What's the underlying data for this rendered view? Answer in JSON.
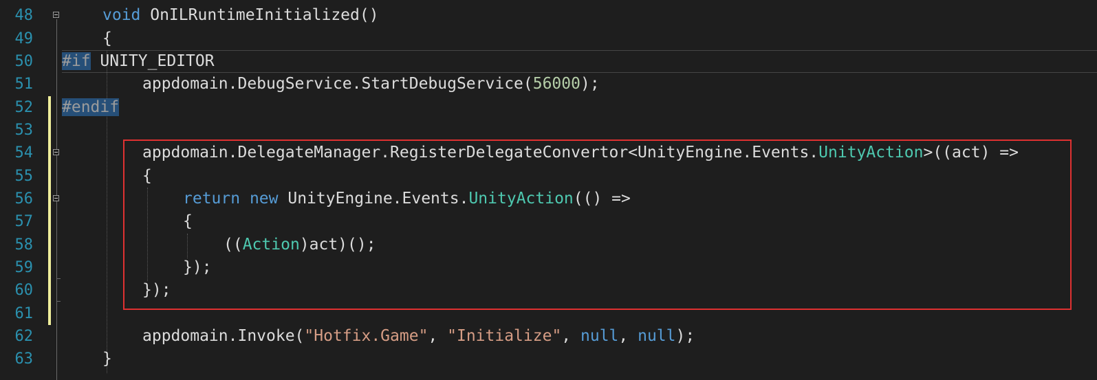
{
  "editor": {
    "language": "C#",
    "colors": {
      "background": "#1e1e1e",
      "line_number": "#2b91af",
      "keyword": "#569cd6",
      "type": "#4ec9b0",
      "number": "#b5cea8",
      "string": "#d69d85",
      "preprocessor": "#9b9b9b",
      "selection": "#264f78",
      "change_marker": "#f0ef9c",
      "annotation_box": "#e03131"
    },
    "lines": [
      {
        "num": "48",
        "tokens": [
          "void",
          " OnILRuntimeInitialized()"
        ]
      },
      {
        "num": "49",
        "tokens": [
          "{"
        ]
      },
      {
        "num": "50",
        "tokens": [
          "#if",
          " UNITY_EDITOR"
        ]
      },
      {
        "num": "51",
        "tokens": [
          "appdomain.DebugService.StartDebugService(",
          "56000",
          ");"
        ]
      },
      {
        "num": "52",
        "tokens": [
          "#endif"
        ]
      },
      {
        "num": "53",
        "tokens": []
      },
      {
        "num": "54",
        "tokens": [
          "appdomain.DelegateManager.RegisterDelegateConvertor<UnityEngine.Events.",
          "UnityAction",
          ">((act) =>"
        ]
      },
      {
        "num": "55",
        "tokens": [
          "{"
        ]
      },
      {
        "num": "56",
        "tokens": [
          "return",
          " ",
          "new",
          " UnityEngine.Events.",
          "UnityAction",
          "(() =>"
        ]
      },
      {
        "num": "57",
        "tokens": [
          "{"
        ]
      },
      {
        "num": "58",
        "tokens": [
          "((",
          "Action",
          ")act)();"
        ]
      },
      {
        "num": "59",
        "tokens": [
          "});"
        ]
      },
      {
        "num": "60",
        "tokens": [
          "});"
        ]
      },
      {
        "num": "61",
        "tokens": []
      },
      {
        "num": "62",
        "tokens": [
          "appdomain.Invoke(",
          "\"Hotfix.Game\"",
          ", ",
          "\"Initialize\"",
          ", ",
          "null",
          ", ",
          "null",
          ");"
        ]
      },
      {
        "num": "63",
        "tokens": [
          "}"
        ]
      }
    ]
  }
}
